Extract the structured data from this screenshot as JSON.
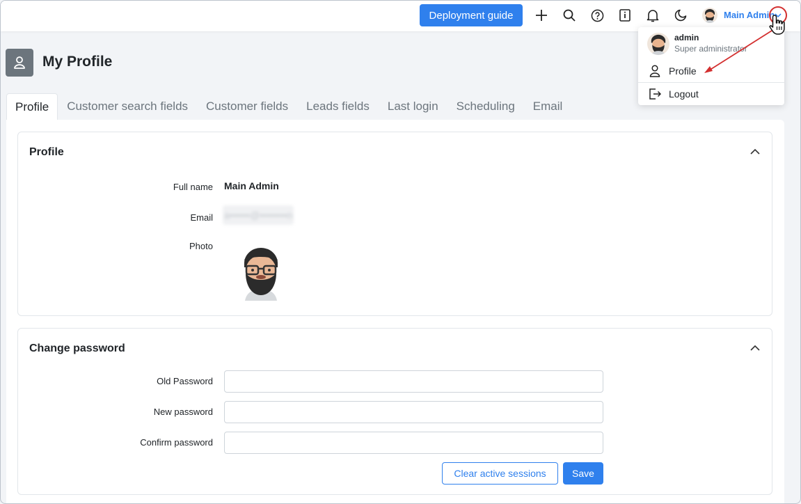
{
  "topbar": {
    "deploy_label": "Deployment guide",
    "user_name": "Main Admin",
    "icons": [
      "plus-icon",
      "search-icon",
      "help-icon",
      "info-icon",
      "bell-icon",
      "moon-icon"
    ]
  },
  "page": {
    "title": "My Profile"
  },
  "tabs": [
    {
      "label": "Profile",
      "active": true
    },
    {
      "label": "Customer search fields"
    },
    {
      "label": "Customer fields"
    },
    {
      "label": "Leads fields"
    },
    {
      "label": "Last login"
    },
    {
      "label": "Scheduling"
    },
    {
      "label": "Email"
    }
  ],
  "profile_card": {
    "title": "Profile",
    "full_name_label": "Full name",
    "full_name_value": "Main Admin",
    "email_label": "Email",
    "email_value": "a••••••@••••••••n",
    "photo_label": "Photo"
  },
  "password_card": {
    "title": "Change password",
    "old_label": "Old Password",
    "new_label": "New password",
    "confirm_label": "Confirm password",
    "old_value": "",
    "new_value": "",
    "confirm_value": "",
    "clear_sessions_label": "Clear active sessions",
    "save_label": "Save"
  },
  "dropdown": {
    "username": "admin",
    "role": "Super administrator",
    "profile_label": "Profile",
    "logout_label": "Logout"
  },
  "colors": {
    "accent": "#2f80ed",
    "annotation": "#d32f2f"
  }
}
